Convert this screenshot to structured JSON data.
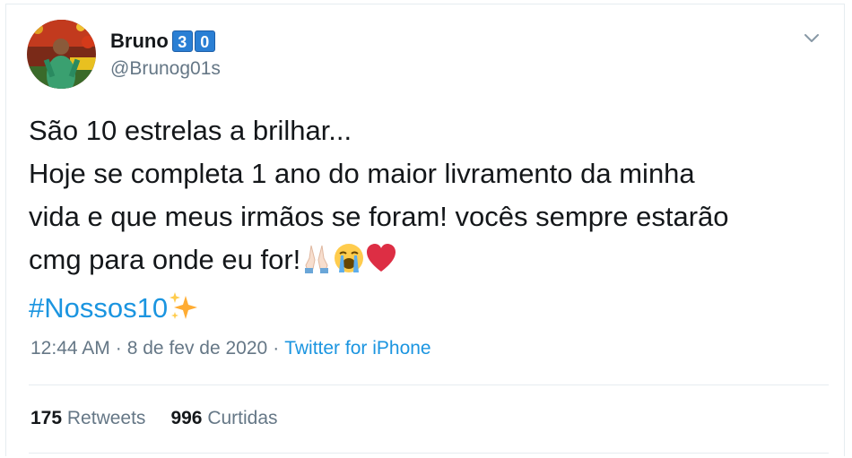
{
  "user": {
    "display_name": "Bruno",
    "badge_digits": [
      "3",
      "0"
    ],
    "handle": "@Brunog01s",
    "avatar_icon": "profile-photo"
  },
  "tweet": {
    "lines": [
      "São 10 estrelas a brilhar...",
      "Hoje se completa 1 ano do maior livramento da minha",
      "vida e que meus irmãos se foram! vocês sempre estarão",
      "cmg para onde eu for!"
    ],
    "emojis": [
      "folded-hands-emoji",
      "loudly-crying-face-emoji",
      "red-heart-emoji"
    ],
    "hashtag": "#Nossos10",
    "hashtag_emoji": "sparkles-emoji"
  },
  "meta": {
    "time": "12:44 AM",
    "separator": "·",
    "date": "8 de fev de 2020",
    "source": "Twitter for iPhone"
  },
  "stats": {
    "retweets_count": "175",
    "retweets_label": "Retweets",
    "likes_count": "996",
    "likes_label": "Curtidas"
  },
  "colors": {
    "link": "#1b95e0",
    "secondary_text": "#657786",
    "badge": "#2a7fd4"
  }
}
